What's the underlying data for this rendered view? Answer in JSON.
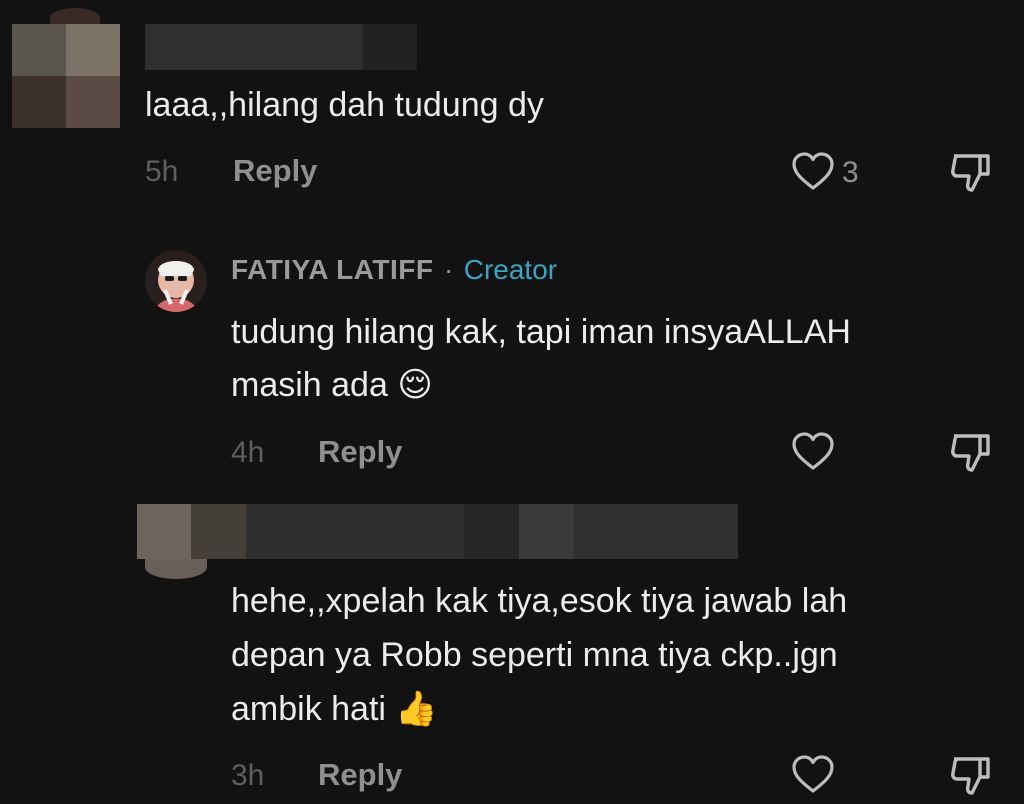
{
  "comments": [
    {
      "text": "laaa,,hilang dah tudung dy",
      "time": "5h",
      "reply_label": "Reply",
      "like_count": "3"
    },
    {
      "author": "FATIYA LATIFF",
      "separator": "·",
      "badge": "Creator",
      "text_lines": [
        "tudung hilang kak, tapi iman insyaALLAH",
        "masih ada 😌"
      ],
      "time": "4h",
      "reply_label": "Reply"
    },
    {
      "text_lines": [
        "hehe,,xpelah kak tiya,esok tiya jawab lah",
        "depan ya Robb seperti mna tiya ckp..jgn",
        "ambik hati 👍"
      ],
      "time": "3h",
      "reply_label": "Reply"
    }
  ],
  "icons": {
    "like": "heart-icon",
    "dislike": "thumbs-down-icon"
  },
  "colors": {
    "background": "#121212",
    "creator_badge": "#39a3c4"
  }
}
